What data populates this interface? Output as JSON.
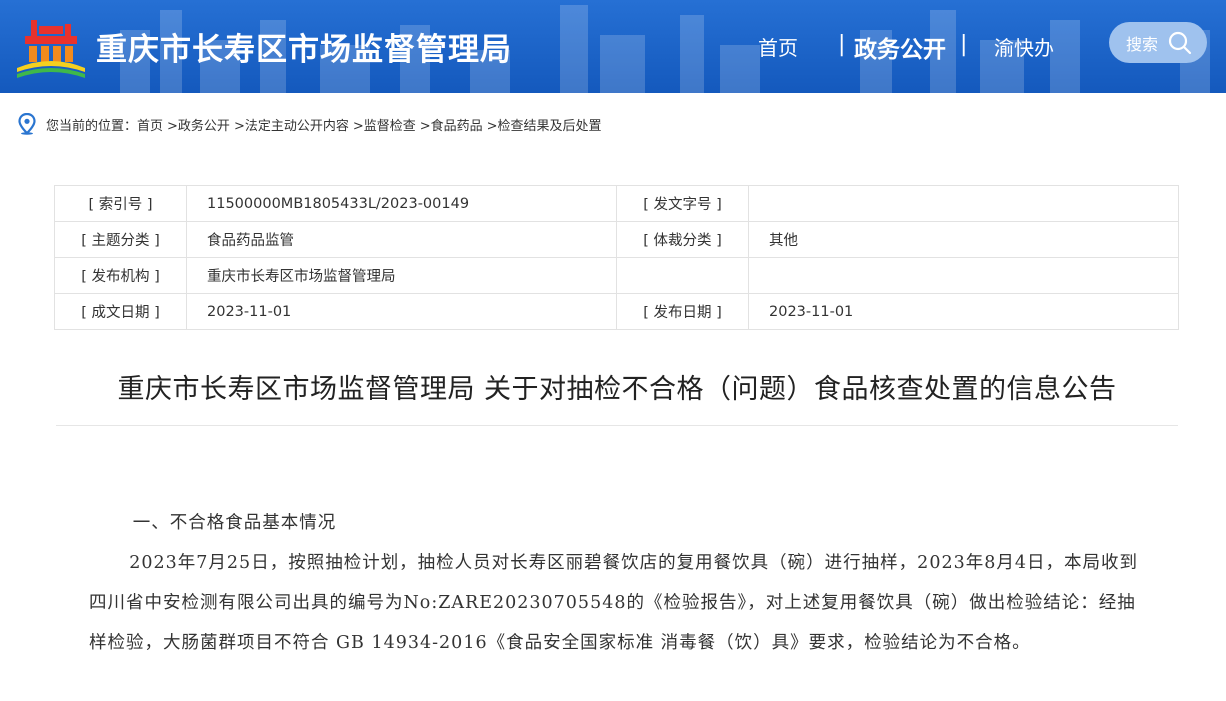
{
  "header": {
    "site_title": "重庆市长寿区市场监督管理局",
    "nav": {
      "home": "首页",
      "sep": "|",
      "gov": "政务公开",
      "yu": "渝快办"
    },
    "search_label": "搜索"
  },
  "breadcrumb": {
    "prefix": "您当前的位置：",
    "items": [
      "首页",
      ">政务公开",
      ">法定主动公开内容",
      ">监督检查",
      ">食品药品",
      ">检查结果及后处置"
    ]
  },
  "meta": {
    "rows": [
      {
        "k1": "[ 索引号 ]",
        "v1": "11500000MB1805433L/2023-00149",
        "k2": "[ 发文字号 ]",
        "v2": ""
      },
      {
        "k1": "[ 主题分类 ]",
        "v1": "食品药品监管",
        "k2": "[ 体裁分类 ]",
        "v2": "其他"
      },
      {
        "k1": "[ 发布机构 ]",
        "v1": "重庆市长寿区市场监督管理局",
        "k2": "",
        "v2": ""
      },
      {
        "k1": "[ 成文日期 ]",
        "v1": "2023-11-01",
        "k2": "[ 发布日期 ]",
        "v2": "2023-11-01"
      }
    ]
  },
  "article": {
    "title": "重庆市长寿区市场监督管理局 关于对抽检不合格（问题）食品核查处置的信息公告",
    "section1": "一、不合格食品基本情况",
    "para1": "2023年7月25日，按照抽检计划，抽检人员对长寿区丽碧餐饮店的复用餐饮具（碗）进行抽样，2023年8月4日，本局收到四川省中安检测有限公司出具的编号为No:ZARE20230705548的《检验报告》，对上述复用餐饮具（碗）做出检验结论：经抽样检验，大肠菌群项目不符合 GB 14934-2016《食品安全国家标准 消毒餐（饮）具》要求，检验结论为不合格。"
  },
  "colors": {
    "header_bg": "#1a5fc1",
    "search_bg": "#9fc2ee",
    "pin_blue": "#2a75d0"
  }
}
